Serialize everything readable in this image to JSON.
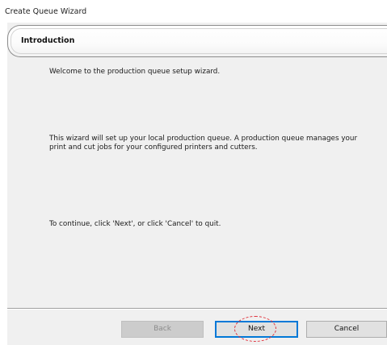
{
  "window": {
    "title": "Create Queue Wizard"
  },
  "header": {
    "title": "Introduction"
  },
  "body": {
    "paragraph_1": "Welcome to the production queue setup wizard.",
    "paragraph_2_line_1": "This wizard will set up your local production queue. A production queue manages your",
    "paragraph_2_line_2": "print and cut jobs for your configured printers and cutters.",
    "paragraph_3": "To continue, click 'Next', or click 'Cancel' to quit."
  },
  "footer": {
    "back_label": "Back",
    "back_enabled": false,
    "next_label": "Next",
    "next_focused": true,
    "cancel_label": "Cancel"
  },
  "annotation": {
    "highlight_target": "next-button",
    "highlight_color": "#e0303b"
  },
  "colors": {
    "dialog_background": "#f0f0f0",
    "focus_border": "#0078d7"
  }
}
